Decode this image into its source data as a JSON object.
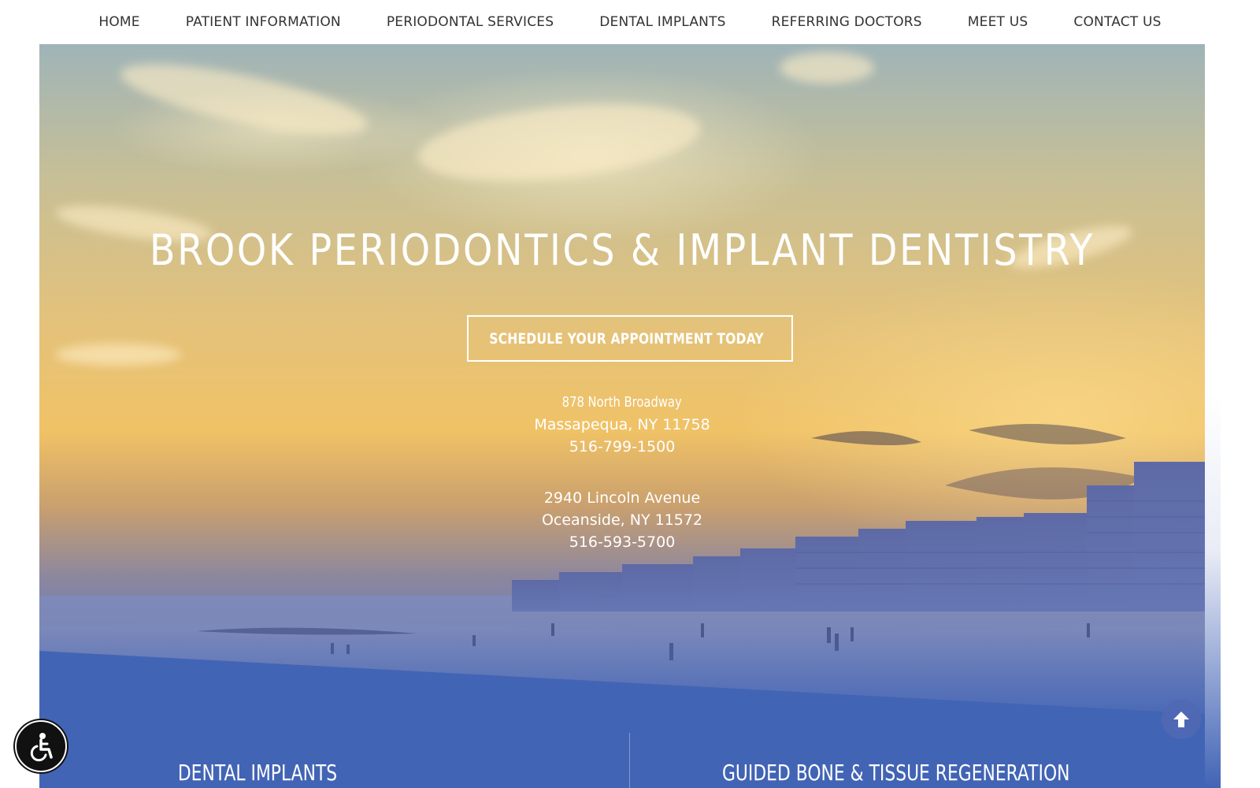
{
  "nav": {
    "items": [
      {
        "label": "HOME"
      },
      {
        "label": "PATIENT INFORMATION"
      },
      {
        "label": "PERIODONTAL SERVICES"
      },
      {
        "label": "DENTAL IMPLANTS"
      },
      {
        "label": "REFERRING DOCTORS"
      },
      {
        "label": "MEET US"
      },
      {
        "label": "CONTACT US"
      }
    ]
  },
  "hero": {
    "title": "BROOK PERIODONTICS & IMPLANT DENTISTRY",
    "cta_label": "SCHEDULE YOUR APPOINTMENT TODAY",
    "cta_icon": "calendar-icon",
    "locations": [
      {
        "street": "878 North Broadway",
        "city": "Massapequa, NY 11758",
        "phone": "516-799-1500"
      },
      {
        "street": "2940 Lincoln Avenue",
        "city": "Oceanside, NY 11572",
        "phone": "516-593-5700"
      }
    ]
  },
  "features": {
    "left_title": "DENTAL IMPLANTS",
    "right_title": "GUIDED BONE & TISSUE REGENERATION"
  },
  "widgets": {
    "scroll_top_icon": "arrow-up-circle-icon",
    "accessibility_icon": "wheelchair-icon"
  },
  "colors": {
    "band_blue": "#4264b5",
    "nav_text": "#333333",
    "hero_text": "#ffffff"
  }
}
